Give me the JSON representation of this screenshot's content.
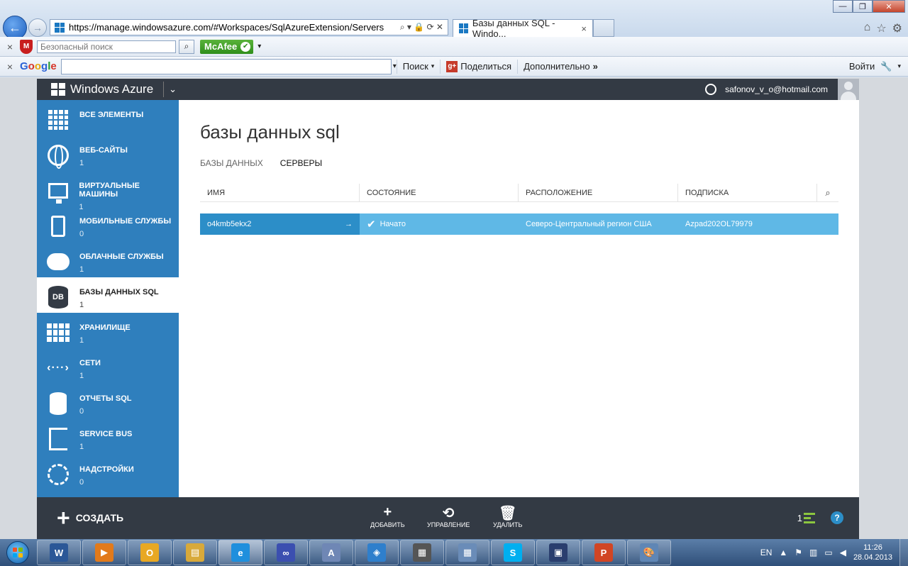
{
  "browser": {
    "url": "https://manage.windowsazure.com/#Workspaces/SqlAzureExtension/Servers",
    "tab_title": "Базы данных SQL - Windo...",
    "tab_close": "×",
    "back_arrow": "←",
    "fwd_arrow": "→",
    "addr_controls": "⌕ ▾ 🔒 ⟳ ✕",
    "win_min": "—",
    "win_max": "❐",
    "win_close": "✕",
    "home_icon": "⌂",
    "fav_icon": "☆",
    "settings_icon": "⚙"
  },
  "toolbar1": {
    "close": "×",
    "shield": "M",
    "safe_search_placeholder": "Безопасный поиск",
    "search_btn": "⌕",
    "mcafee": "McAfee",
    "mcafee_ok": "✔",
    "dropdown": "▾"
  },
  "toolbar2": {
    "close": "×",
    "google": [
      "G",
      "o",
      "o",
      "g",
      "l",
      "e"
    ],
    "search_drop": "▾",
    "search_label": "Поиск",
    "search_drop2": "▾",
    "share_icon": "g+",
    "share_label": "Поделиться",
    "more_label": "Дополнительно",
    "more_chev": "»",
    "login_label": "Войти",
    "wrench": "🔧",
    "wrench_drop": "▾"
  },
  "portal": {
    "brand": "Windows Azure",
    "brand_chevron": "⌄",
    "account": "safonov_v_o@hotmail.com",
    "page_title": "базы данных sql",
    "subtabs": [
      "БАЗЫ ДАННЫХ",
      "СЕРВЕРЫ"
    ],
    "active_subtab": 1
  },
  "sidebar": {
    "items": [
      {
        "label": "ВСЕ ЭЛЕМЕНТЫ",
        "count": ""
      },
      {
        "label": "ВЕБ-САЙТЫ",
        "count": "1"
      },
      {
        "label": "ВИРТУАЛЬНЫЕ МАШИНЫ",
        "count": "1"
      },
      {
        "label": "МОБИЛЬНЫЕ СЛУЖБЫ",
        "count": "0"
      },
      {
        "label": "ОБЛАЧНЫЕ СЛУЖБЫ",
        "count": "1"
      },
      {
        "label": "БАЗЫ ДАННЫХ SQL",
        "count": "1",
        "icon_text": "DB"
      },
      {
        "label": "ХРАНИЛИЩЕ",
        "count": "1"
      },
      {
        "label": "СЕТИ",
        "count": "1",
        "icon_text": "‹···›"
      },
      {
        "label": "ОТЧЕТЫ SQL",
        "count": "0"
      },
      {
        "label": "SERVICE BUS",
        "count": "1"
      },
      {
        "label": "НАДСТРОЙКИ",
        "count": "0"
      }
    ],
    "active_index": 5
  },
  "grid": {
    "columns": [
      "ИМЯ",
      "СОСТОЯНИЕ",
      "РАСПОЛОЖЕНИЕ",
      "ПОДПИСКА"
    ],
    "search_icon": "⌕",
    "rows": [
      {
        "name": "o4kmb5ekx2",
        "arrow": "→",
        "status_icon": "✔",
        "status": "Начато",
        "location": "Северо-Центральный регион США",
        "subscription": "Azpad202OL79979"
      }
    ]
  },
  "commandbar": {
    "create_icon": "+",
    "create": "СОЗДАТЬ",
    "add_icon": "+",
    "add": "ДОБАВИТЬ",
    "manage_icon": "⟲",
    "manage": "УПРАВЛЕНИЕ",
    "delete_icon": "🗑",
    "delete": "УДАЛИТЬ",
    "notifications": "1",
    "help": "?"
  },
  "taskbar": {
    "apps": [
      {
        "name": "word",
        "label": "W",
        "color": "#2b5797"
      },
      {
        "name": "media-player",
        "label": "▶",
        "color": "#e27a1b"
      },
      {
        "name": "outlook",
        "label": "O",
        "color": "#e8a823"
      },
      {
        "name": "explorer",
        "label": "▤",
        "color": "#d8a93a"
      },
      {
        "name": "ie",
        "label": "e",
        "color": "#1f8fdd"
      },
      {
        "name": "app-infinity",
        "label": "∞",
        "color": "#3b4fb0"
      },
      {
        "name": "app-notepad",
        "label": "A",
        "color": "#6f87b5"
      },
      {
        "name": "app-box",
        "label": "◈",
        "color": "#2f7fcc"
      },
      {
        "name": "app-film",
        "label": "▦",
        "color": "#555"
      },
      {
        "name": "calculator",
        "label": "▦",
        "color": "#6a8cb8"
      },
      {
        "name": "skype",
        "label": "S",
        "color": "#00aff0"
      },
      {
        "name": "app-save",
        "label": "▣",
        "color": "#2a3e6e"
      },
      {
        "name": "powerpoint",
        "label": "P",
        "color": "#d14524"
      },
      {
        "name": "paint",
        "label": "🎨",
        "color": "#5f86b5"
      }
    ],
    "active_index": 4,
    "lang": "EN",
    "tray_up": "▲",
    "tray_flag": "⚑",
    "tray_net": "▥",
    "tray_pc": "▭",
    "tray_vol": "◀",
    "time": "11:26",
    "date": "28.04.2013"
  }
}
